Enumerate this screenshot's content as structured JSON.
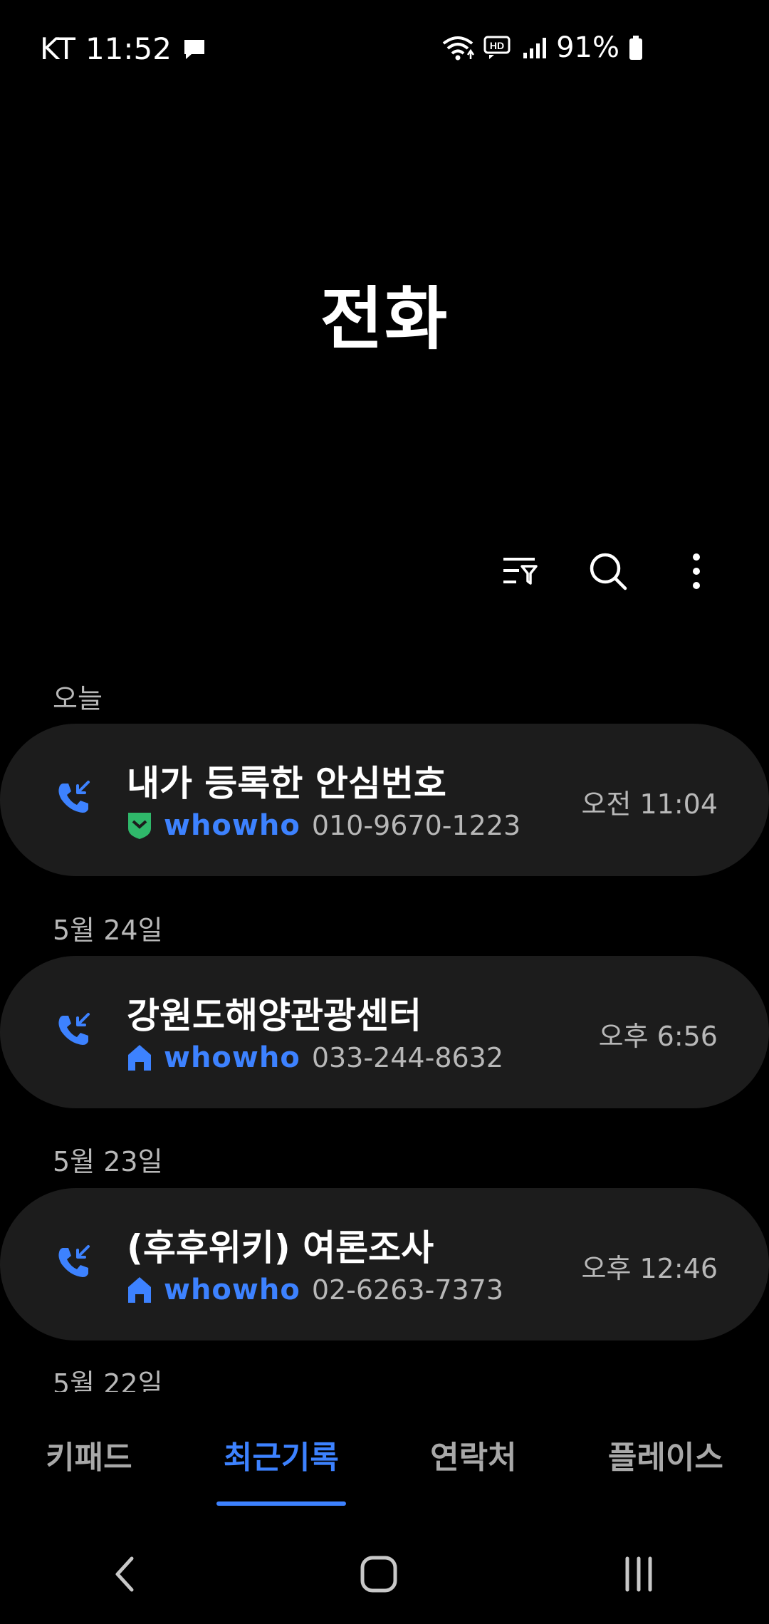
{
  "status": {
    "carrier": "KT",
    "time": "11:52",
    "battery": "91%"
  },
  "title": "전화",
  "sections": [
    {
      "label": "오늘",
      "name": "내가 등록한 안심번호",
      "brand": "whowho",
      "number": "010-9670-1223",
      "time": "오전 11:04",
      "badge": "shield-icon"
    },
    {
      "label": "5월 24일",
      "name": "강원도해양관광센터",
      "brand": "whowho",
      "number": "033-244-8632",
      "time": "오후 6:56",
      "badge": "building-icon"
    },
    {
      "label": "5월 23일",
      "name": "(후후위키) 여론조사",
      "brand": "whowho",
      "number": "02-6263-7373",
      "time": "오후 12:46",
      "badge": "building-icon"
    }
  ],
  "partial_section_label": "5월 22일",
  "tabs": [
    "키패드",
    "최근기록",
    "연락처",
    "플레이스"
  ],
  "active_tab": "최근기록",
  "colors": {
    "accent": "#3d82ff",
    "card": "#1c1c1c",
    "shield": "#2fb86a"
  }
}
